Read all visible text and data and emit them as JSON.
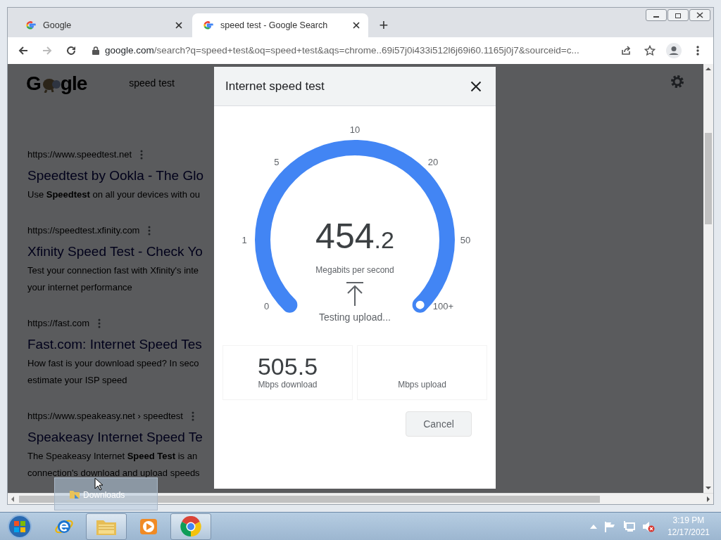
{
  "browser": {
    "tabs": [
      {
        "title": "Google",
        "selected": false
      },
      {
        "title": "speed test - Google Search",
        "selected": true
      }
    ],
    "new_tab": "+",
    "url_host": "google.com",
    "url_rest": "/search?q=speed+test&oq=speed+test&aqs=chrome..69i57j0i433i512l6j69i60.1165j0j7&sourceid=c..."
  },
  "page": {
    "logo_left": "G",
    "logo_right": "gle",
    "search_query": "speed test",
    "results": [
      {
        "url": "https://www.speedtest.net",
        "title": "Speedtest by Ookla - The Glo",
        "snippet": [
          "Use **Speedtest** on all your devices with ou"
        ]
      },
      {
        "url": "https://speedtest.xfinity.com",
        "title": "Xfinity Speed Test - Check Yo",
        "snippet": [
          "Test your connection fast with Xfinity's inte",
          "your internet performance"
        ]
      },
      {
        "url": "https://fast.com",
        "title": "Fast.com: Internet Speed Tes",
        "snippet": [
          "How fast is your download speed? In seco",
          "estimate your ISP speed"
        ]
      },
      {
        "url": "https://www.speakeasy.net › speedtest",
        "title": "Speakeasy Internet Speed Te",
        "snippet": [
          "The Speakeasy Internet **Speed Test** is an",
          "connection's download and upload speeds"
        ]
      }
    ]
  },
  "dialog": {
    "title": "Internet speed test",
    "ticks": [
      "0",
      "1",
      "5",
      "10",
      "20",
      "50",
      "100+"
    ],
    "value_whole": "454",
    "value_fraction": ".2",
    "unit": "Megabits per second",
    "status": "Testing upload...",
    "stats": [
      {
        "value": "505.5",
        "label": "Mbps download"
      },
      {
        "label": "Mbps upload"
      }
    ],
    "cancel": "Cancel"
  },
  "drag_label": "Downloads",
  "taskbar": {
    "apps": [
      {
        "kind": "ie",
        "selected": false
      },
      {
        "kind": "folder",
        "selected": true
      },
      {
        "kind": "media",
        "selected": false
      },
      {
        "kind": "chrome",
        "selected": true
      }
    ],
    "time": "3:19 PM",
    "date": "12/17/2021"
  }
}
